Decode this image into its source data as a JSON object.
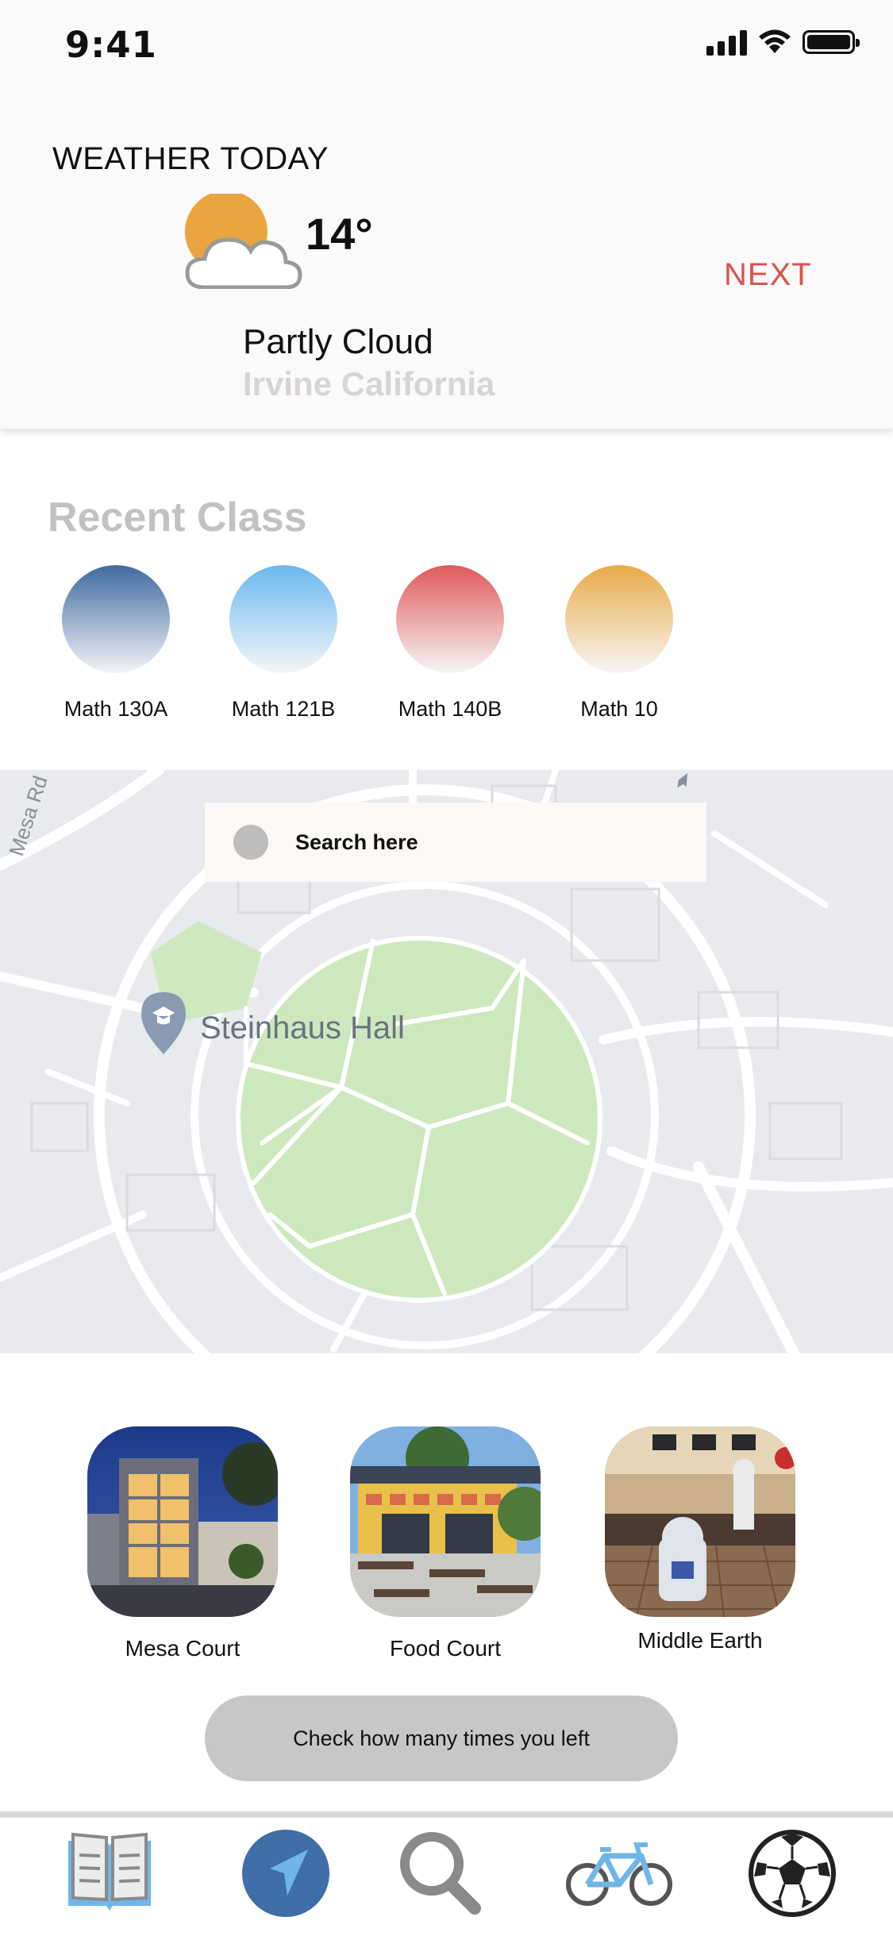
{
  "status_bar": {
    "time": "9:41"
  },
  "weather": {
    "title": "WEATHER TODAY",
    "temperature": "14°",
    "condition": "Partly Cloud",
    "location": "Irvine California",
    "next_label": "NEXT",
    "icon": "partly-cloudy-icon"
  },
  "recent_class": {
    "title": "Recent Class",
    "classes": [
      {
        "label": "Math 130A",
        "color": "#3f6aa0"
      },
      {
        "label": "Math 121B",
        "color": "#6ab8ef"
      },
      {
        "label": "Math 140B",
        "color": "#e05a5a"
      },
      {
        "label": "Math 10",
        "color": "#e9aa48"
      }
    ]
  },
  "map": {
    "search_placeholder": "Search here",
    "pin_label": "Steinhaus Hall",
    "street_label": "Mesa Rd"
  },
  "places": [
    {
      "label": "Mesa Court"
    },
    {
      "label": "Food Court"
    },
    {
      "label": "Middle Earth"
    }
  ],
  "check_button_label": "Check how many times you left",
  "tabbar": {
    "tabs": [
      {
        "icon": "book-icon"
      },
      {
        "icon": "navigation-icon"
      },
      {
        "icon": "search-icon"
      },
      {
        "icon": "bicycle-icon"
      },
      {
        "icon": "soccer-ball-icon"
      }
    ]
  }
}
